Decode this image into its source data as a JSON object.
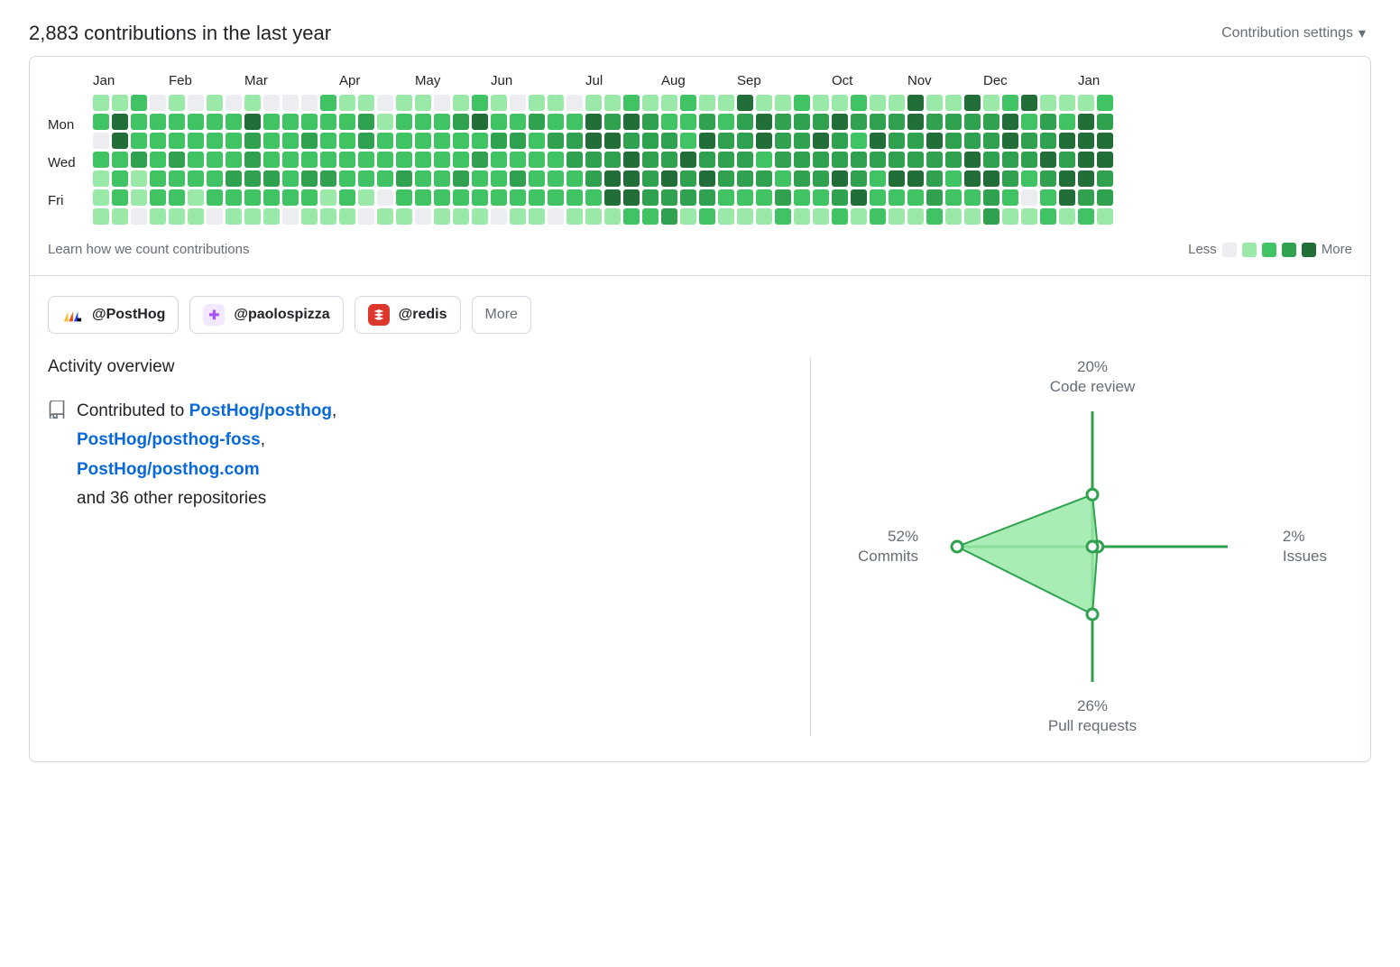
{
  "header": {
    "title": "2,883 contributions in the last year",
    "settings_label": "Contribution settings"
  },
  "calendar": {
    "months": [
      "Jan",
      "Feb",
      "Mar",
      "Apr",
      "May",
      "Jun",
      "Jul",
      "Aug",
      "Sep",
      "Oct",
      "Nov",
      "Dec",
      "Jan"
    ],
    "month_week_offsets": [
      0,
      4,
      8,
      13,
      17,
      21,
      26,
      30,
      34,
      39,
      43,
      47,
      52
    ],
    "day_labels": [
      "",
      "Mon",
      "",
      "Wed",
      "",
      "Fri",
      ""
    ],
    "learn_link": "Learn how we count contributions",
    "legend_less": "Less",
    "legend_more": "More",
    "weeks": [
      [
        1,
        2,
        0,
        2,
        1,
        1,
        1
      ],
      [
        1,
        4,
        4,
        2,
        2,
        2,
        1
      ],
      [
        2,
        2,
        2,
        3,
        1,
        1,
        0
      ],
      [
        0,
        2,
        2,
        2,
        2,
        2,
        1
      ],
      [
        1,
        2,
        2,
        3,
        2,
        2,
        1
      ],
      [
        0,
        2,
        2,
        2,
        2,
        1,
        1
      ],
      [
        1,
        2,
        2,
        2,
        2,
        2,
        0
      ],
      [
        0,
        2,
        2,
        2,
        3,
        2,
        1
      ],
      [
        1,
        4,
        3,
        3,
        3,
        2,
        1
      ],
      [
        0,
        2,
        2,
        2,
        3,
        2,
        1
      ],
      [
        0,
        2,
        2,
        2,
        2,
        2,
        0
      ],
      [
        0,
        2,
        3,
        2,
        3,
        2,
        1
      ],
      [
        2,
        2,
        2,
        2,
        3,
        1,
        1
      ],
      [
        1,
        2,
        2,
        2,
        2,
        2,
        1
      ],
      [
        1,
        3,
        3,
        2,
        2,
        1,
        0
      ],
      [
        0,
        1,
        2,
        2,
        2,
        0,
        1
      ],
      [
        1,
        2,
        2,
        2,
        3,
        2,
        1
      ],
      [
        1,
        2,
        2,
        2,
        2,
        2,
        0
      ],
      [
        0,
        2,
        2,
        2,
        2,
        2,
        1
      ],
      [
        1,
        3,
        2,
        2,
        3,
        2,
        1
      ],
      [
        2,
        4,
        2,
        3,
        2,
        2,
        1
      ],
      [
        1,
        2,
        3,
        2,
        2,
        2,
        0
      ],
      [
        0,
        2,
        3,
        2,
        3,
        2,
        1
      ],
      [
        1,
        3,
        2,
        2,
        2,
        2,
        1
      ],
      [
        1,
        2,
        3,
        2,
        2,
        2,
        0
      ],
      [
        0,
        2,
        3,
        3,
        2,
        2,
        1
      ],
      [
        1,
        4,
        4,
        3,
        3,
        2,
        1
      ],
      [
        1,
        3,
        4,
        3,
        4,
        4,
        1
      ],
      [
        2,
        4,
        3,
        4,
        4,
        4,
        2
      ],
      [
        1,
        3,
        3,
        3,
        3,
        3,
        2
      ],
      [
        1,
        2,
        3,
        3,
        4,
        3,
        3
      ],
      [
        2,
        2,
        2,
        4,
        3,
        3,
        1
      ],
      [
        1,
        3,
        4,
        3,
        4,
        3,
        2
      ],
      [
        1,
        2,
        3,
        3,
        3,
        2,
        1
      ],
      [
        4,
        3,
        3,
        3,
        3,
        2,
        1
      ],
      [
        1,
        4,
        4,
        2,
        3,
        2,
        1
      ],
      [
        1,
        3,
        3,
        3,
        2,
        3,
        2
      ],
      [
        2,
        3,
        3,
        3,
        3,
        2,
        1
      ],
      [
        1,
        3,
        4,
        3,
        3,
        2,
        1
      ],
      [
        1,
        4,
        3,
        3,
        4,
        3,
        2
      ],
      [
        2,
        3,
        2,
        3,
        3,
        4,
        1
      ],
      [
        1,
        3,
        4,
        3,
        2,
        2,
        2
      ],
      [
        1,
        3,
        3,
        3,
        4,
        2,
        1
      ],
      [
        4,
        4,
        3,
        3,
        4,
        2,
        1
      ],
      [
        1,
        3,
        4,
        3,
        3,
        3,
        2
      ],
      [
        1,
        3,
        3,
        3,
        2,
        2,
        1
      ],
      [
        4,
        3,
        3,
        4,
        4,
        2,
        1
      ],
      [
        1,
        3,
        3,
        3,
        4,
        3,
        3
      ],
      [
        2,
        4,
        4,
        3,
        3,
        2,
        1
      ],
      [
        4,
        2,
        3,
        3,
        2,
        0,
        1
      ],
      [
        1,
        3,
        3,
        4,
        3,
        2,
        2
      ],
      [
        1,
        2,
        4,
        3,
        4,
        4,
        1
      ],
      [
        1,
        4,
        4,
        4,
        4,
        3,
        2
      ],
      [
        2,
        3,
        4,
        4,
        3,
        3,
        1
      ]
    ]
  },
  "orgs": {
    "items": [
      {
        "label": "@PostHog",
        "color": "#fff"
      },
      {
        "label": "@paolospizza",
        "color": "#f3e8ff"
      },
      {
        "label": "@redis",
        "color": "#dc382d"
      }
    ],
    "more_label": "More"
  },
  "activity": {
    "heading": "Activity overview",
    "prefix": "Contributed to ",
    "repos": [
      "PostHog/posthog",
      "PostHog/posthog-foss",
      "PostHog/posthog.com"
    ],
    "suffix": " and 36 other repositories"
  },
  "chart_data": {
    "type": "radar",
    "axes": [
      "Code review",
      "Issues",
      "Pull requests",
      "Commits"
    ],
    "values": [
      20,
      2,
      26,
      52
    ],
    "labels": {
      "code_review_pct": "20%",
      "code_review_name": "Code review",
      "issues_pct": "2%",
      "issues_name": "Issues",
      "pr_pct": "26%",
      "pr_name": "Pull requests",
      "commits_pct": "52%",
      "commits_name": "Commits"
    }
  }
}
